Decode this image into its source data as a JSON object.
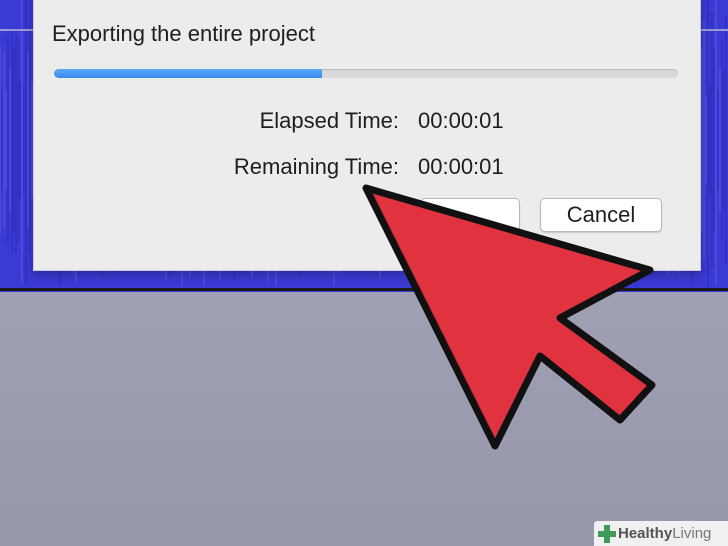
{
  "dialog": {
    "title": "Exporting the entire project",
    "progress_fraction": 0.43,
    "elapsed_label": "Elapsed Time:",
    "elapsed_value": "00:00:01",
    "remaining_label": "Remaining Time:",
    "remaining_value": "00:00:01",
    "cancel_label": "Cancel"
  },
  "watermark": {
    "brand_bold": "Healthy",
    "brand_regular": "Living"
  },
  "colors": {
    "waveform": "#3a3ad4",
    "progress_fill": "#3788ee",
    "arrow_fill": "#e0323f",
    "watermark_icon": "#3f9a5a"
  },
  "icons": {
    "arrow": "red-pointer-arrow-icon",
    "watermark": "plus-cross-icon"
  }
}
